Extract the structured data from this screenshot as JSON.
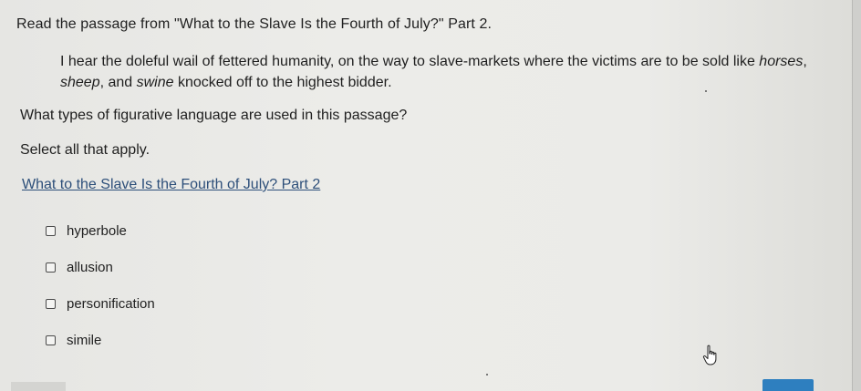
{
  "question": {
    "title": "Read the passage from \"What to the Slave Is the Fourth of July?\" Part 2.",
    "passage": {
      "text_1": "I hear the doleful wail of fettered humanity, on the way to slave-markets where the victims are to be sold like ",
      "italic_1": "horses",
      "text_2": ",",
      "italic_2": "sheep",
      "text_3": ", and ",
      "italic_3": "swine",
      "text_4": " knocked off to the highest bidder."
    },
    "prompt": "What types of figurative language are used in this passage?",
    "instruction": "Select all that apply.",
    "resource_link": "What to the Slave Is the Fourth of July? Part 2"
  },
  "options": [
    {
      "label": "hyperbole",
      "checked": false
    },
    {
      "label": "allusion",
      "checked": false
    },
    {
      "label": "personification",
      "checked": false
    },
    {
      "label": "simile",
      "checked": false
    }
  ],
  "icons": {
    "cursor": "hand-pointer-icon"
  },
  "colors": {
    "link": "#2d4f7a",
    "submit": "#2e7fbf"
  }
}
